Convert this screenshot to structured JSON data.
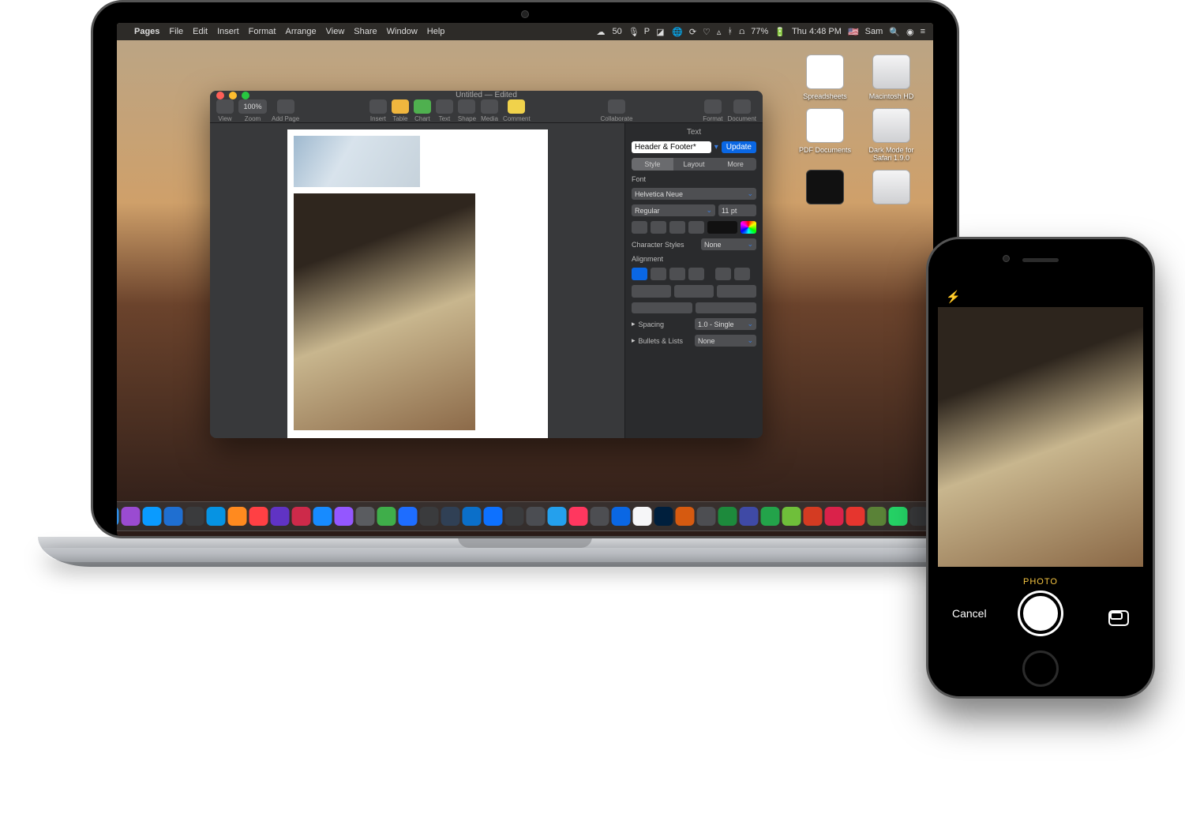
{
  "menubar": {
    "app": "Pages",
    "items": [
      "File",
      "Edit",
      "Insert",
      "Format",
      "Arrange",
      "View",
      "Share",
      "Window",
      "Help"
    ],
    "status_num": "50",
    "battery": "77%",
    "day_time": "Thu 4:48 PM",
    "user": "Sam"
  },
  "desktop": {
    "icons": [
      {
        "name": "Spreadsheets",
        "kind": "doc"
      },
      {
        "name": "Macintosh HD",
        "kind": "hd"
      },
      {
        "name": "PDF Documents",
        "kind": "doc"
      },
      {
        "name": "Dark Mode for Safari 1.9.0",
        "kind": "hd"
      },
      {
        "name": "",
        "kind": "app"
      },
      {
        "name": "",
        "kind": "hd"
      }
    ]
  },
  "pages_window": {
    "title": "Untitled — Edited",
    "traffic": {
      "close": "#ff5f57",
      "min": "#febc2e",
      "max": "#28c840"
    },
    "toolbar": {
      "left": [
        {
          "label": "View"
        },
        {
          "label": "Zoom",
          "value": "100%"
        },
        {
          "label": "Add Page"
        }
      ],
      "center": [
        {
          "label": "Insert"
        },
        {
          "label": "Table"
        },
        {
          "label": "Chart"
        },
        {
          "label": "Text"
        },
        {
          "label": "Shape"
        },
        {
          "label": "Media"
        },
        {
          "label": "Comment"
        }
      ],
      "right_a": [
        {
          "label": "Collaborate"
        }
      ],
      "right_b": [
        {
          "label": "Format"
        },
        {
          "label": "Document"
        }
      ]
    },
    "inspector": {
      "panel_title": "Text",
      "header_footer": "Header & Footer*",
      "update": "Update",
      "tabs": [
        "Style",
        "Layout",
        "More"
      ],
      "font_label": "Font",
      "font_family": "Helvetica Neue",
      "font_style": "Regular",
      "font_size": "11 pt",
      "char_styles_label": "Character Styles",
      "char_styles_value": "None",
      "alignment_label": "Alignment",
      "spacing_label": "Spacing",
      "spacing_value": "1.0 - Single",
      "bullets_label": "Bullets & Lists",
      "bullets_value": "None"
    }
  },
  "dock": {
    "colors": [
      "#2e8de6",
      "#9a4bd1",
      "#0a9bff",
      "#1f6fd1",
      "#3a3b3d",
      "#0693e3",
      "#ff8a1f",
      "#ff4044",
      "#6033c4",
      "#cd2a4a",
      "#178bff",
      "#9457ff",
      "#5a5c60",
      "#3fae4a",
      "#1e6dff",
      "#3a3b3d",
      "#304055",
      "#0b6fc9",
      "#0d71ff",
      "#3a3b3d",
      "#4b4d52",
      "#24a0ed",
      "#ff375f",
      "#4d4e52",
      "#0a67e4",
      "#f6f6f8",
      "#001f3d",
      "#d65a10",
      "#4d4e52",
      "#1d8a3c",
      "#3f4aa6",
      "#23a34a",
      "#6fbf3a",
      "#d43b22",
      "#da224a",
      "#e6352e",
      "#5a8237",
      "#25d366",
      "#3a3b3d",
      "#5a5c60"
    ]
  },
  "iphone": {
    "mode": "PHOTO",
    "cancel": "Cancel"
  }
}
